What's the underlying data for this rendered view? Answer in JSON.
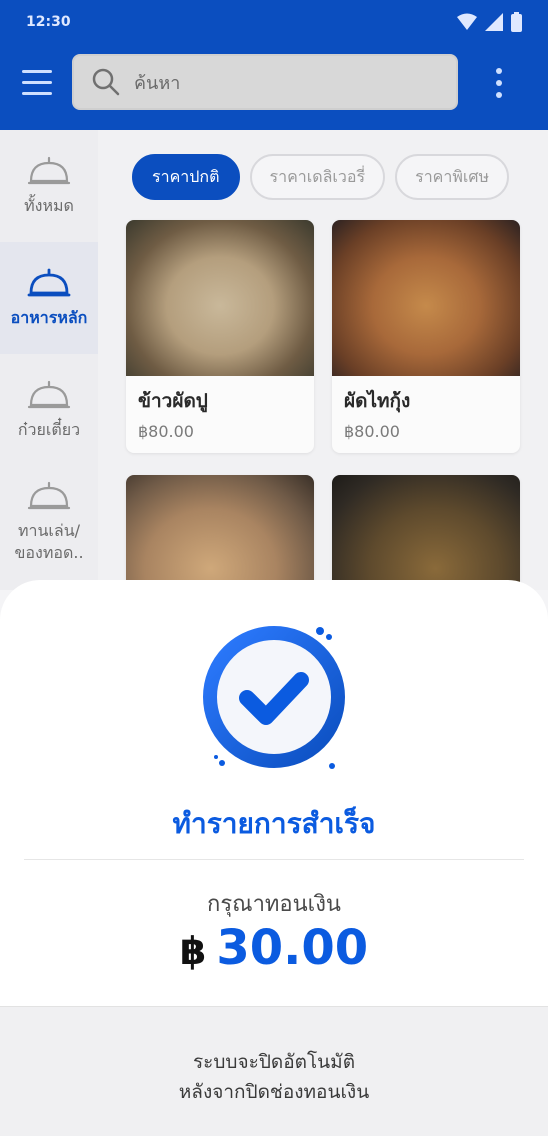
{
  "status": {
    "time": "12:30"
  },
  "header": {
    "search_placeholder": "ค้นหา"
  },
  "sidebar": {
    "items": [
      {
        "label": "ทั้งหมด",
        "icon": "cloche-icon",
        "active": false
      },
      {
        "label": "อาหารหลัก",
        "icon": "cloche-icon",
        "active": true
      },
      {
        "label": "ก๋วยเตี๋ยว",
        "icon": "cloche-icon",
        "active": false
      },
      {
        "label": "ทานเล่น/ของทอด..",
        "icon": "cloche-icon",
        "active": false
      }
    ]
  },
  "tabs": [
    {
      "label": "ราคาปกติ",
      "active": true
    },
    {
      "label": "ราคาเดลิเวอรี่",
      "active": false
    },
    {
      "label": "ราคาพิเศษ",
      "active": false
    }
  ],
  "products": [
    {
      "name": "ข้าวผัดปู",
      "price": "฿80.00"
    },
    {
      "name": "ผัดไทกุ้ง",
      "price": "฿80.00"
    },
    {
      "name": "",
      "price": ""
    },
    {
      "name": "",
      "price": ""
    }
  ],
  "dialog": {
    "title": "ทำรายการสำเร็จ",
    "subtitle": "กรุณาทอนเงิน",
    "currency": "฿",
    "amount": "30.00",
    "footer_line1": "ระบบจะปิดอัตโนมัติ",
    "footer_line2": "หลังจากปิดช่องทอนเงิน"
  },
  "colors": {
    "primary": "#0b4ebf",
    "accent": "#0b5be0"
  }
}
